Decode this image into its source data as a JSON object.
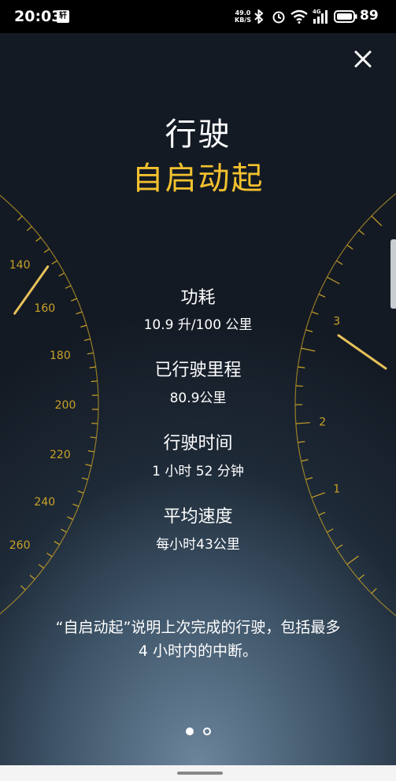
{
  "status_bar": {
    "time": "20:03",
    "notification_badge": "轩",
    "net_speed_value": "49.0",
    "net_speed_unit": "KB/S",
    "network_type": "4G",
    "battery_level": "89",
    "icons": [
      "bluetooth-icon",
      "alarm-icon",
      "wifi-icon",
      "signal-icon",
      "battery-icon"
    ]
  },
  "header": {
    "title": "行驶",
    "subtitle": "自启动起"
  },
  "stats": [
    {
      "label": "功耗",
      "value": "10.9 升/100 公里"
    },
    {
      "label": "已行驶里程",
      "value": "80.9公里"
    },
    {
      "label": "行驶时间",
      "value": "1 小时 52 分钟"
    },
    {
      "label": "平均速度",
      "value": "每小时43公里"
    }
  ],
  "description": {
    "line1": "“自启动起”说明上次完成的行驶，包括最多",
    "line2": "4 小时内的中断。"
  },
  "gauges": {
    "speedometer_labels": [
      "140",
      "160",
      "180",
      "200",
      "220",
      "240",
      "260"
    ],
    "tachometer_labels": [
      "3",
      "2",
      "1"
    ]
  },
  "pager": {
    "total": 2,
    "current": 1
  },
  "colors": {
    "accent": "#f2c12e",
    "gauge": "#c9a227",
    "text": "#ffffff",
    "background_top": "#141a24",
    "background_bottom": "#6c859b"
  }
}
